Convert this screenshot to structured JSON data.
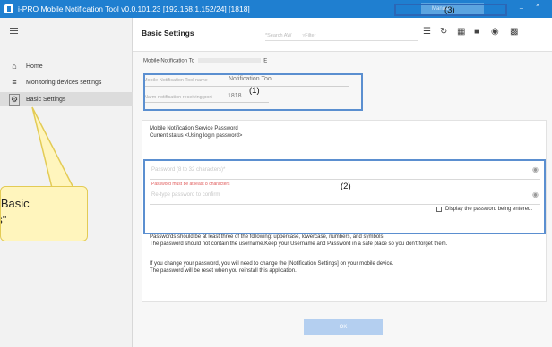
{
  "window": {
    "title": "i-PRO Mobile Notification Tool  v0.0.101.23 [192.168.1.152/24] [1818]",
    "manual_label": "Manual",
    "minimize": "_",
    "close": "×"
  },
  "sidebar": {
    "items": [
      {
        "label": "Home",
        "icon": "home-icon"
      },
      {
        "label": "Monitoring devices settings",
        "icon": "devices-icon"
      },
      {
        "label": "Basic Settings",
        "icon": "gear-icon"
      }
    ]
  },
  "toolbar": {
    "title": "Basic Settings",
    "search_placeholder": "*Search AW",
    "filter_placeholder": "Filter",
    "icons": [
      "view-options-icon",
      "refresh-icon",
      "qr-code-icon",
      "delete-icon",
      "broadcast-icon",
      "message-icon"
    ]
  },
  "form": {
    "mobile_notification_label": "Mobile Notification To",
    "mobile_notification_suffix": "E",
    "tool_name_label": "Mobile Notification Tool name",
    "tool_name_value": "Notification Tool",
    "alarm_port_label": "Alarm notification receiving port",
    "alarm_port_value": "1818"
  },
  "password_panel": {
    "heading": "Mobile Notification Service Password",
    "status": "Current status  <Using login password>",
    "password_placeholder": "Password (8 to 32 characters)*",
    "password_error": "Password must be at least 8 characters",
    "confirm_placeholder": "Re-type password to confirm",
    "display_password_label": "Display the password being entered.",
    "note_line1": "Passwords should be at least three of the following: uppercase, lowercase, numbers, and symbols.",
    "note_line2": "The password should not contain the username.Keep your Username and Password in a safe place so you don't forget them.",
    "note_line3": "If you change your password, you will need to change the [Notification Settings] on your mobile device.",
    "note_line4": "The password will be reset when you reinstall this application."
  },
  "ok_label": "OK",
  "annotations": {
    "label1": "(1)",
    "label2": "(2)",
    "label3": "(3)",
    "callout_line1": "t \"Basic",
    "callout_line2": "gs\""
  },
  "colors": {
    "titlebar": "#1f7fd0",
    "annotation_border": "#5b8fd0",
    "callout_fill": "#fff5bd",
    "error": "#e05a5a",
    "ok_button": "#b4cff0"
  }
}
